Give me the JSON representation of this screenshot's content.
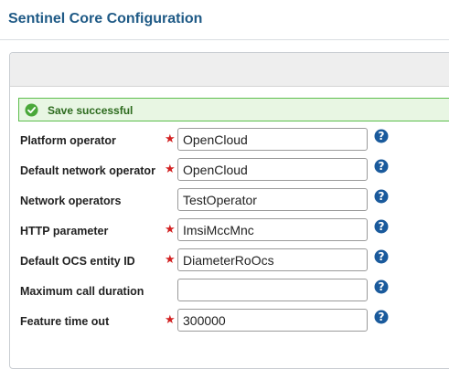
{
  "page": {
    "title": "Sentinel Core Configuration"
  },
  "banner": {
    "message": "Save successful",
    "icon": "check-circle-icon",
    "color": "#5cbd4c"
  },
  "form": {
    "rows": [
      {
        "label": "Platform operator",
        "required": true,
        "value": "OpenCloud",
        "help_icon": "question-mark-icon"
      },
      {
        "label": "Default network operator",
        "required": true,
        "value": "OpenCloud",
        "help_icon": "question-mark-icon"
      },
      {
        "label": "Network operators",
        "required": false,
        "value": "TestOperator",
        "help_icon": "question-mark-icon"
      },
      {
        "label": "HTTP parameter",
        "required": true,
        "value": "ImsiMccMnc",
        "help_icon": "question-mark-icon"
      },
      {
        "label": "Default OCS entity ID",
        "required": true,
        "value": "DiameterRoOcs",
        "help_icon": "question-mark-icon"
      },
      {
        "label": "Maximum call duration",
        "required": false,
        "value": "",
        "help_icon": "question-mark-icon"
      },
      {
        "label": "Feature time out",
        "required": true,
        "value": "300000",
        "help_icon": "question-mark-icon"
      }
    ],
    "required_marker": "★"
  },
  "colors": {
    "title": "#1f5a86",
    "required": "#d22020",
    "help": "#1a5a9c"
  }
}
